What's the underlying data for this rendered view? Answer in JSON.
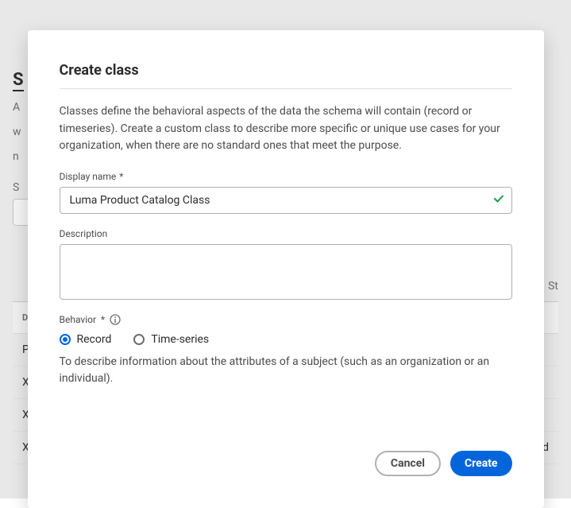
{
  "background": {
    "heading": "S",
    "text_line1": "A",
    "text_line2": "w",
    "text_line3": "n",
    "search_label": "S",
    "tab_right": "St",
    "table_header": "DISP",
    "rows": [
      {
        "name": "Pay",
        "type": ""
      },
      {
        "name": "XDM",
        "type": ""
      },
      {
        "name": "XDM",
        "type": ""
      },
      {
        "name": "XDM Business Marketing List Membe",
        "type": "Record"
      }
    ]
  },
  "modal": {
    "title": "Create class",
    "description": "Classes define the behavioral aspects of the data the schema will contain (record or timeseries). Create a custom class to describe more specific or unique use cases for your organization, when there are no standard ones that meet the purpose.",
    "display_name_label": "Display name",
    "display_name_value": "Luma Product Catalog Class",
    "description_label": "Description",
    "description_value": "",
    "behavior_label": "Behavior",
    "radio_record": "Record",
    "radio_timeseries": "Time-series",
    "behavior_help": "To describe information about the attributes of a subject (such as an organization or an individual).",
    "cancel_label": "Cancel",
    "create_label": "Create"
  }
}
